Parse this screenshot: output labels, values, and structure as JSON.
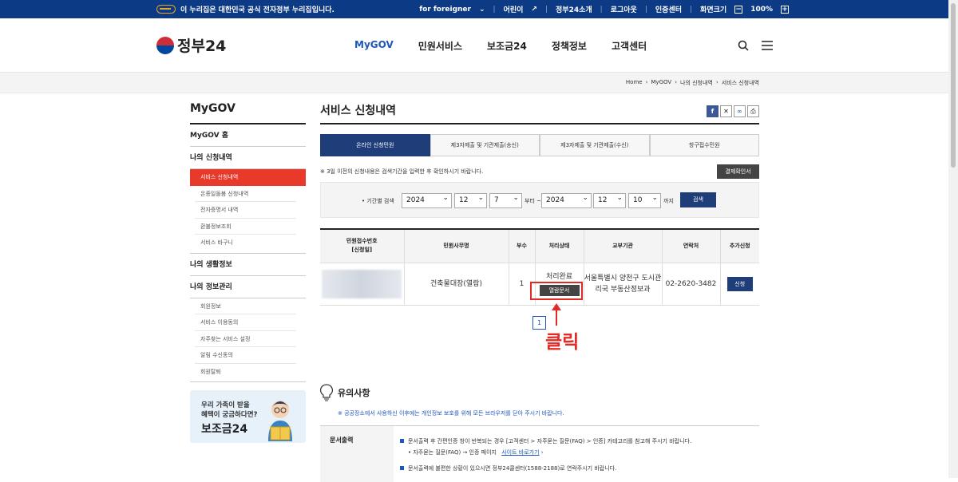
{
  "topbar": {
    "gov_notice": "이 누리집은 대한민국 공식 전자정부 누리집입니다.",
    "links": [
      "for foreigner",
      "어린이",
      "정부24소개",
      "로그아웃",
      "인증센터",
      "화면크기"
    ],
    "zoom": "100%",
    "zoom_minus": "−",
    "zoom_plus": "+"
  },
  "header": {
    "logo_text": "정부24",
    "nav": [
      "MyGOV",
      "민원서비스",
      "보조금24",
      "정책정보",
      "고객센터"
    ]
  },
  "breadcrumb": [
    "Home",
    "MyGOV",
    "나의 신청내역",
    "서비스 신청내역"
  ],
  "sidebar": {
    "title": "MyGOV",
    "home": "MyGOV 홈",
    "section1": "나의 신청내역",
    "section1_items": [
      "서비스 신청내역",
      "온종일돌봄 신청내역",
      "전자증명서 내역",
      "환불정보조회",
      "서비스 바구니"
    ],
    "section2": "나의 생활정보",
    "section3": "나의 정보관리",
    "section3_items": [
      "회원정보",
      "서비스 이용동의",
      "자주찾는 서비스 설정",
      "알림 수신동의",
      "회원탈퇴"
    ],
    "banner_text1": "우리 가족이 받을",
    "banner_text2": "혜택이 궁금하다면?",
    "banner_text3": "보조금24"
  },
  "main": {
    "title": "서비스 신청내역",
    "tabs": [
      "온라인 신청민원",
      "제3자제출 및 기관제출(송신)",
      "제3자제출 및 기관제출(수신)",
      "창구접수민원"
    ],
    "notice": "※ 3일 이전의 신청내용은 검색기간을 입력한 후 확인하시기 바랍니다.",
    "result_button": "결제확인서",
    "search": {
      "label": "• 기간별 검색",
      "from_year": "2024",
      "from_month": "12",
      "from_day": "7",
      "from_text": "부터 ~",
      "to_year": "2024",
      "to_month": "12",
      "to_day": "10",
      "to_text": "까지",
      "button": "검색"
    },
    "table": {
      "headers": [
        "민원접수번호\n[신청일]",
        "민원사무명",
        "부수",
        "처리상태",
        "교부기관",
        "연락처",
        "추가신청"
      ],
      "row": {
        "name": "건축물대장(열람)",
        "count": "1",
        "status": "처리완료",
        "view_button": "열람문서",
        "agency": "서울특별시 양천구 도시관리국 부동산정보과",
        "contact": "02-2620-3482",
        "apply_button": "신청"
      }
    },
    "page": "1",
    "annotation": "클릭",
    "caution": {
      "title": "유의사항",
      "note": "※ 공공장소에서 사용하신 이후에는 개인정보 보호를 위해 모든 브라우저를 닫아 주시기 바랍니다.",
      "row_key": "문서출력",
      "line1": "문서출력 후 간편인증 창이 반복되는 경우 [고객센터 > 자주묻는 질문(FAQ) > 인증] 카테고리를 참고해 주시기 바랍니다.",
      "line2": "• 자주묻는 질문(FAQ) → 인증 페이지",
      "link": "사이트 바로가기",
      "line3": "문서출력에 불편한 상황이 있으시면 정부24콜센터(1588-2188)로 연락주시기 바랍니다."
    }
  },
  "colors": {
    "top_bar": "#0d3a85",
    "accent": "#1d56bc",
    "active_side": "#e8392b",
    "annotation": "#e32a25"
  }
}
